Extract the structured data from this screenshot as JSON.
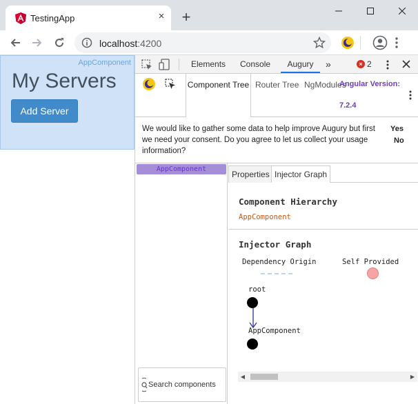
{
  "browser": {
    "tab_title": "TestingApp",
    "tab_close": "×",
    "new_tab": "+",
    "url_host": "localhost",
    "url_port": ":4200"
  },
  "page": {
    "component_label": "AppComponent",
    "title": "My Servers",
    "add_server_label": "Add Server"
  },
  "devtools": {
    "tabs": [
      "Elements",
      "Console",
      "Augury"
    ],
    "more_tabs": "»",
    "error_count": "2",
    "augury": {
      "tabs": [
        "Component Tree",
        "Router Tree",
        "NgModules"
      ],
      "version_label": "Angular Version:",
      "version": "7.2.4"
    },
    "consent": {
      "text": "We would like to gather some data to help improve Augury but first we need your consent. Do you agree to let us collect your usage information?",
      "yes": "Yes",
      "no": "No"
    },
    "tree": {
      "selected_node": "AppComponent",
      "search_placeholder": "Search components"
    },
    "detail": {
      "tabs": [
        "Properties",
        "Injector Graph"
      ],
      "hierarchy_title": "Component Hierarchy",
      "hierarchy_component": "AppComponent",
      "graph_title": "Injector Graph",
      "legend_dependency": "Dependency Origin",
      "legend_self": "Self Provided",
      "node_root": "root",
      "node_app": "AppComponent"
    }
  },
  "colors": {
    "app_box_bg": "#cfe2f7",
    "button_blue": "#428bca",
    "augury_purple": "#6a3fb5",
    "component_orange": "#c35a18",
    "active_tab_blue": "#1a73e8"
  }
}
